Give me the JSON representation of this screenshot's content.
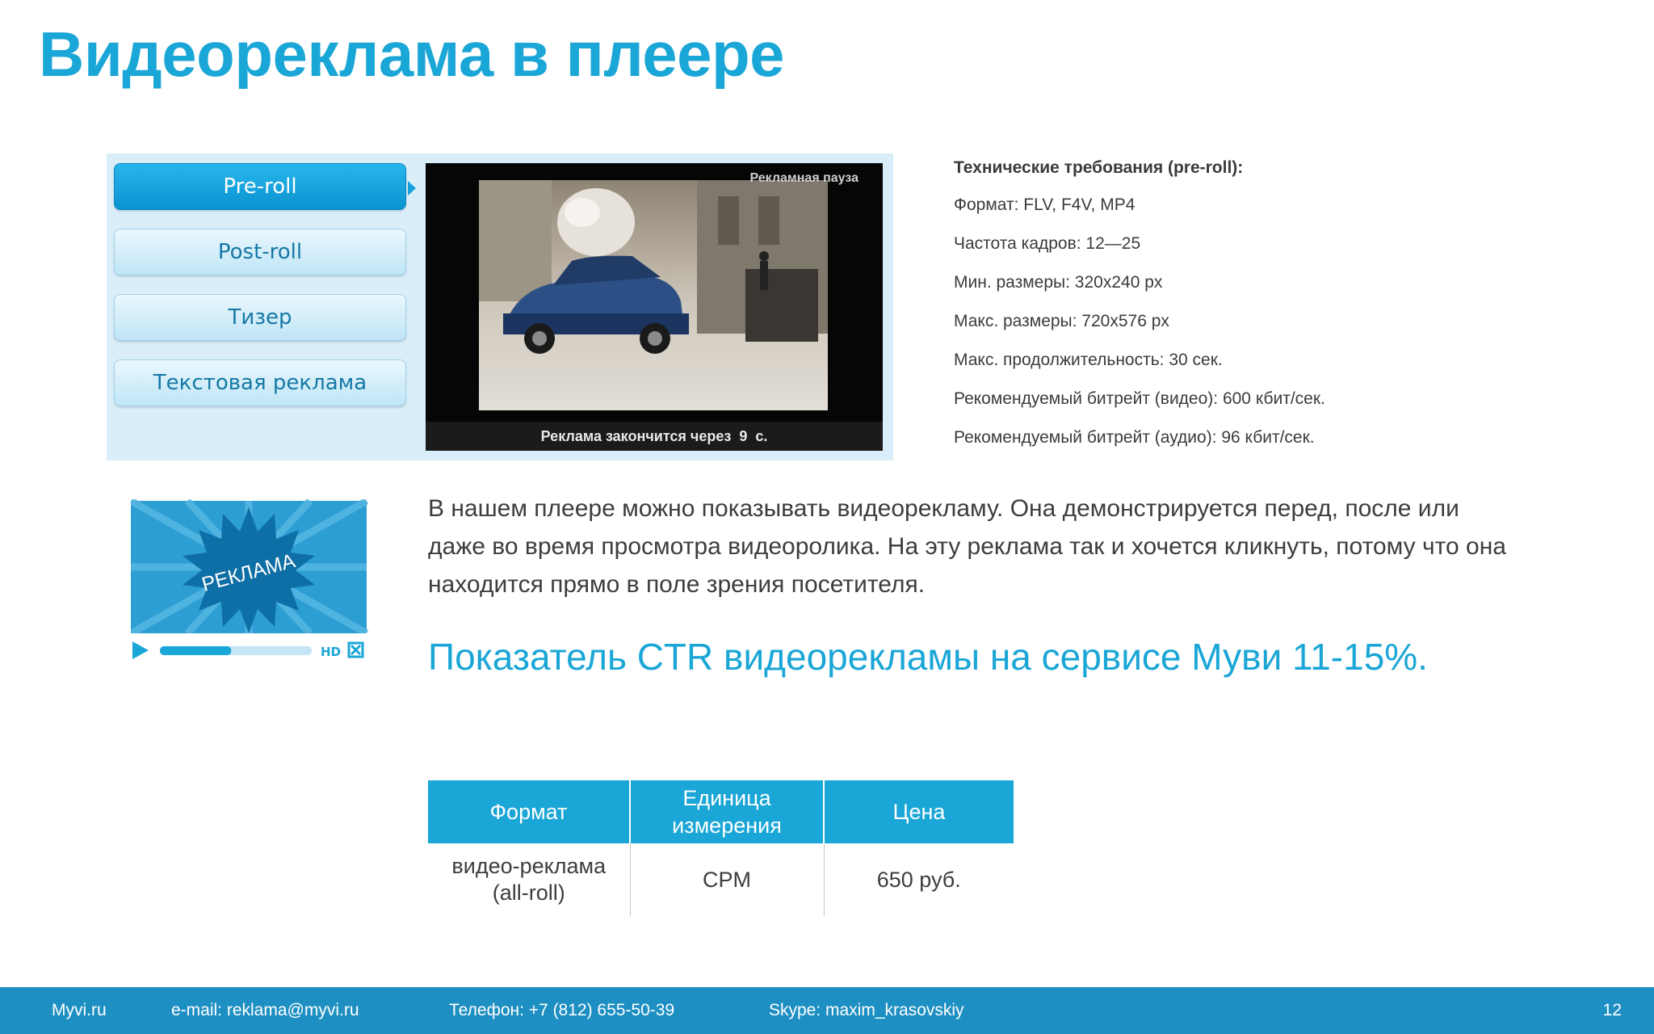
{
  "slide": {
    "title": "Видеореклама в плеере",
    "page_number": "12"
  },
  "player": {
    "menu": [
      {
        "label": "Pre-roll",
        "active": true
      },
      {
        "label": "Post-roll",
        "active": false
      },
      {
        "label": "Тизер",
        "active": false
      },
      {
        "label": "Текстовая реклама",
        "active": false
      }
    ],
    "pause_label": "Рекламная пауза",
    "countdown_text": "Реклама закончится через",
    "countdown_seconds": "9",
    "countdown_unit": "с."
  },
  "ad_illustration": {
    "badge_text": "РЕКЛАМА",
    "hd_label": "HD",
    "progress": 0.47,
    "icons": [
      "play-icon",
      "fullscreen-icon"
    ]
  },
  "tech": {
    "title": "Технические требования (pre-roll):",
    "lines": [
      "Формат: FLV, F4V, MP4",
      "Частота кадров: 12—25",
      "Мин. размеры: 320x240 px",
      "Макс. размеры: 720x576 px",
      "Макс. продолжительность: 30 сек.",
      "Рекомендуемый битрейт (видео): 600 кбит/сек.",
      "Рекомендуемый битрейт (аудио): 96 кбит/сек."
    ]
  },
  "description": "В нашем плеере можно показывать видеорекламу. Она демонстрируется перед, после или даже во время просмотра видеоролика. На эту реклама так и хочется кликнуть, потому что она находится прямо в поле зрения посетителя.",
  "ctr_text": "Показатель CTR видеорекламы на сервисе Муви 11-15%.",
  "pricing_table": {
    "headers": [
      "Формат",
      "Единица измерения",
      "Цена"
    ],
    "rows": [
      [
        "видео-реклама (all-roll)",
        "CPM",
        "650 руб."
      ]
    ]
  },
  "footer": {
    "site": "Myvi.ru",
    "email": "e-mail: reklama@myvi.ru",
    "phone": "Телефон: +7 (812) 655-50-39",
    "skype": "Skype: maxim_krasovskiy"
  },
  "colors": {
    "accent": "#1aa6d6",
    "footer_bg": "#1e8fc2",
    "panel_bg": "#d9eef8"
  }
}
